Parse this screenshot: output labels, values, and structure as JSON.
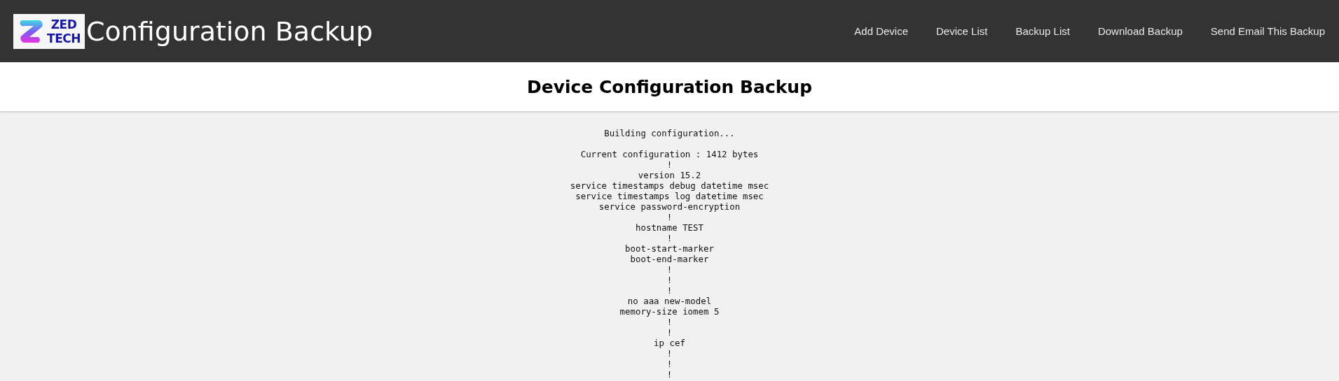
{
  "header": {
    "logo": {
      "line_1": "ZED",
      "line_2": "TECH"
    },
    "title": "Configuration Backup",
    "nav": [
      "Add Device",
      "Device List",
      "Backup List",
      "Download Backup",
      "Send Email This Backup"
    ]
  },
  "page_title": "Device Configuration Backup",
  "config_text": "Building configuration...\n\nCurrent configuration : 1412 bytes\n!\nversion 15.2\nservice timestamps debug datetime msec\nservice timestamps log datetime msec\nservice password-encryption\n!\nhostname TEST\n!\nboot-start-marker\nboot-end-marker\n!\n!\n!\nno aaa new-model\nmemory-size iomem 5\n!\n!\nip cef\n!\n!\n!"
}
